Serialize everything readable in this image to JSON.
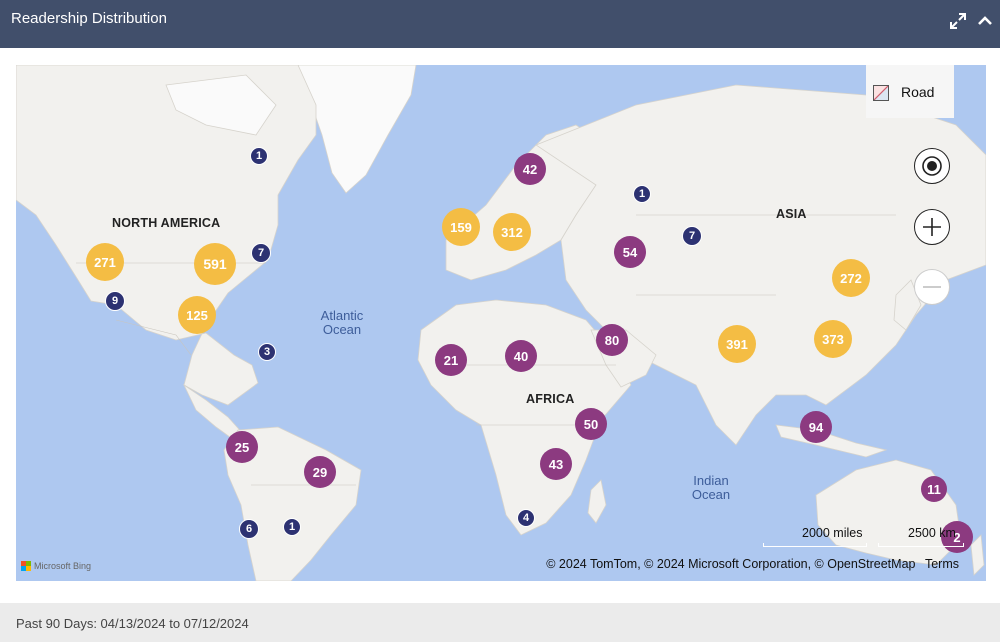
{
  "header": {
    "title": "Readership Distribution",
    "expand_icon": "expand-icon",
    "collapse_icon": "chevron-up-icon"
  },
  "map": {
    "style_label": "Road",
    "regions": [
      "NORTH AMERICA",
      "ASIA",
      "AFRICA"
    ],
    "oceans": [
      [
        "Atlantic",
        "Ocean"
      ],
      [
        "Indian",
        "Ocean"
      ]
    ],
    "clusters": [
      {
        "label": "591",
        "tier": "high"
      },
      {
        "label": "271",
        "tier": "high"
      },
      {
        "label": "125",
        "tier": "high"
      },
      {
        "label": "159",
        "tier": "high"
      },
      {
        "label": "312",
        "tier": "high"
      },
      {
        "label": "391",
        "tier": "high"
      },
      {
        "label": "373",
        "tier": "high"
      },
      {
        "label": "272",
        "tier": "high"
      },
      {
        "label": "42",
        "tier": "mid"
      },
      {
        "label": "54",
        "tier": "mid"
      },
      {
        "label": "80",
        "tier": "mid"
      },
      {
        "label": "21",
        "tier": "mid"
      },
      {
        "label": "40",
        "tier": "mid"
      },
      {
        "label": "50",
        "tier": "mid"
      },
      {
        "label": "43",
        "tier": "mid"
      },
      {
        "label": "94",
        "tier": "mid"
      },
      {
        "label": "25",
        "tier": "mid"
      },
      {
        "label": "29",
        "tier": "mid"
      },
      {
        "label": "11",
        "tier": "mid"
      },
      {
        "label": "2",
        "tier": "mid"
      },
      {
        "label": "1",
        "tier": "low"
      },
      {
        "label": "7",
        "tier": "low"
      },
      {
        "label": "9",
        "tier": "low"
      },
      {
        "label": "3",
        "tier": "low"
      },
      {
        "label": "1",
        "tier": "low"
      },
      {
        "label": "7",
        "tier": "low"
      },
      {
        "label": "6",
        "tier": "low"
      },
      {
        "label": "1",
        "tier": "low"
      },
      {
        "label": "4",
        "tier": "low"
      }
    ],
    "scale_miles": "2000 miles",
    "scale_km": "2500 km",
    "attribution": "© 2024 TomTom, © 2024 Microsoft Corporation, © OpenStreetMap",
    "terms": "Terms",
    "provider": "Microsoft Bing",
    "colors": {
      "high": "#f4bd44",
      "mid": "#8c3a80",
      "low": "#2d3272",
      "water": "#aec8f0",
      "land": "#f2f1ee"
    }
  },
  "footer": {
    "range_text": "Past 90 Days: 04/13/2024 to 07/12/2024"
  }
}
